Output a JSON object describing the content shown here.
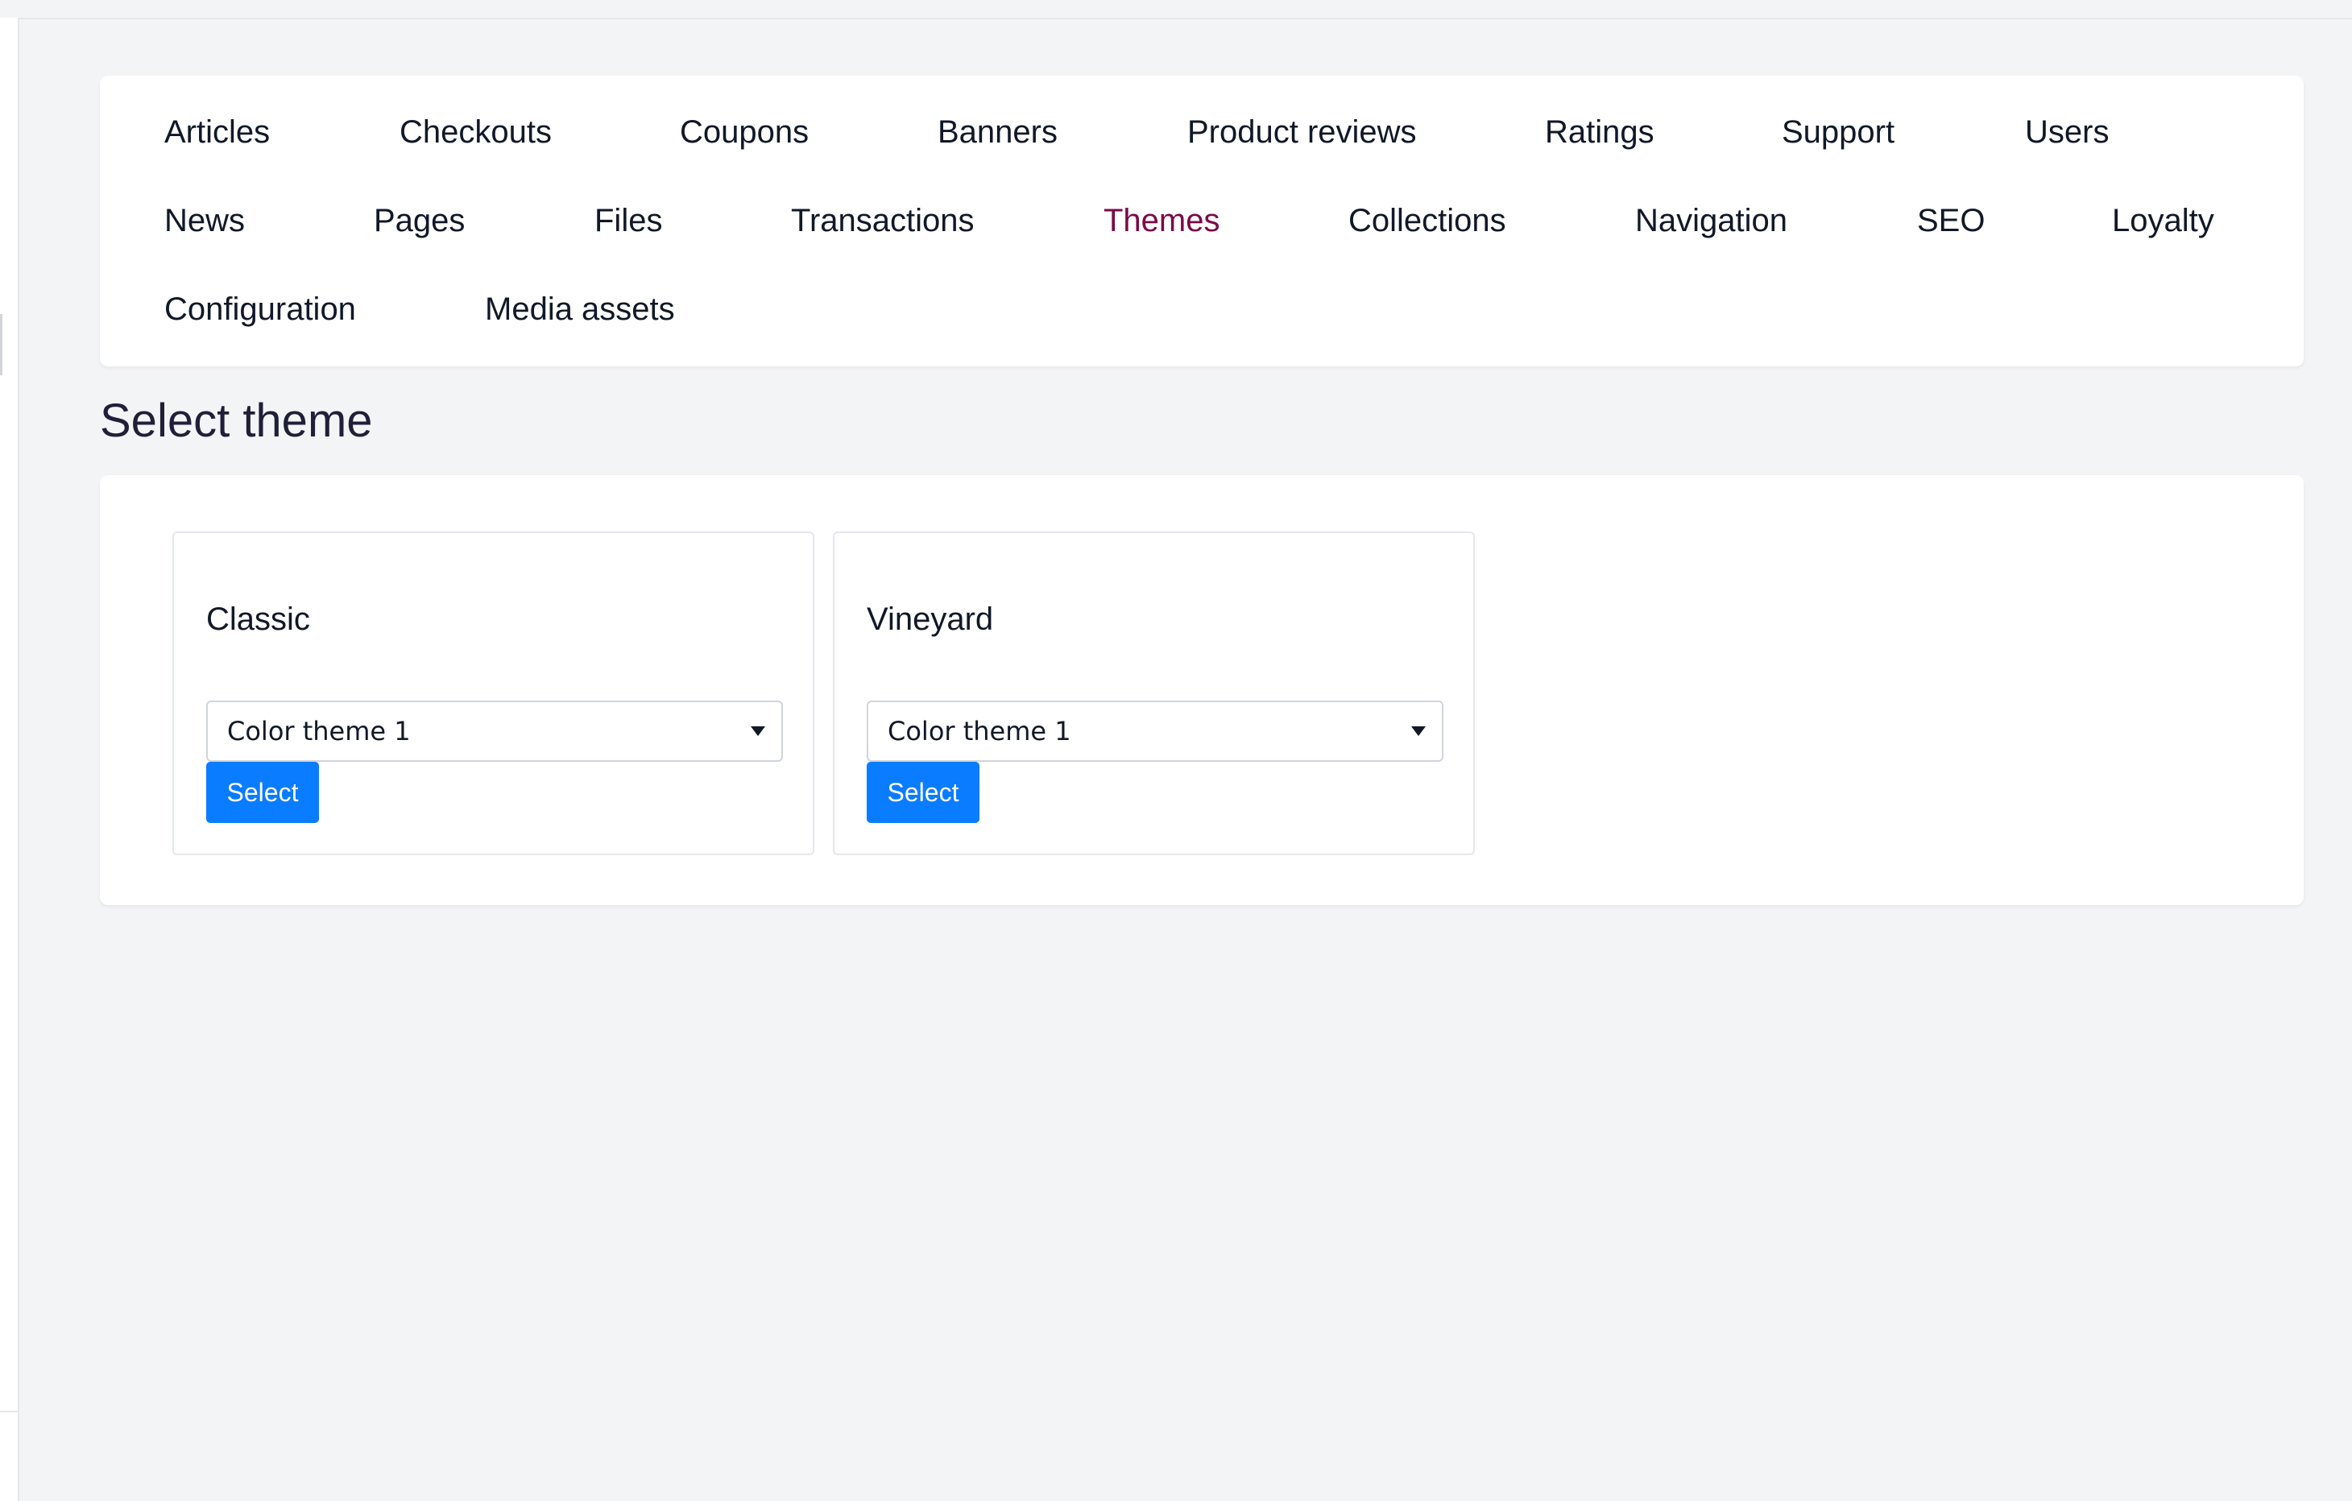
{
  "nav": {
    "row1": [
      "Articles",
      "Checkouts",
      "Coupons",
      "Banners",
      "Product reviews",
      "Ratings",
      "Support",
      "Users"
    ],
    "row2": [
      "News",
      "Pages",
      "Files",
      "Transactions",
      "Themes",
      "Collections",
      "Navigation",
      "SEO",
      "Loyalty"
    ],
    "row3": [
      "Configuration",
      "Media assets"
    ],
    "active": "Themes"
  },
  "page": {
    "title": "Select theme"
  },
  "themes": [
    {
      "name": "Classic",
      "color_theme": "Color theme 1",
      "button_label": "Select"
    },
    {
      "name": "Vineyard",
      "color_theme": "Color theme 1",
      "button_label": "Select"
    }
  ],
  "colors": {
    "accent": "#0a7cff",
    "active_nav": "#7b0a47",
    "background": "#f3f4f6"
  }
}
